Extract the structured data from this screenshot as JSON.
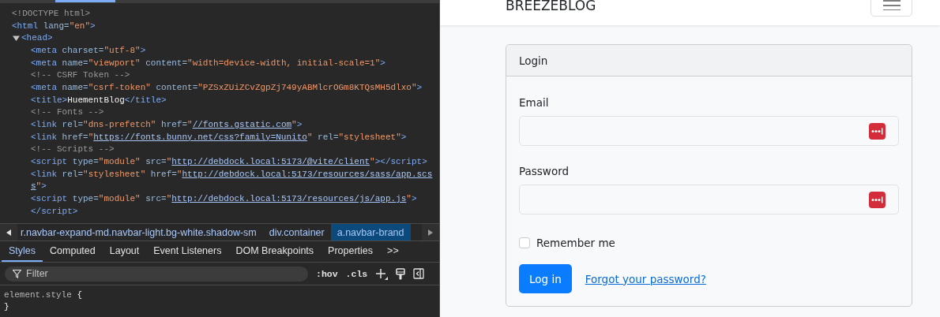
{
  "devtools": {
    "elements_tree": [
      {
        "lines": [
          [
            {
              "kind": "doctype",
              "text": "<!DOCTYPE html>"
            }
          ]
        ]
      },
      {
        "lines": [
          [
            {
              "kind": "tag",
              "text": "<html"
            },
            {
              "kind": "attr",
              "text": " lang="
            },
            {
              "kind": "value",
              "text": "\"en\""
            },
            {
              "kind": "tag",
              "text": ">"
            }
          ]
        ],
        "children": [
          {
            "expanded": true,
            "lines": [
              [
                {
                  "kind": "tag",
                  "text": "<head>"
                }
              ]
            ],
            "children": [
              {
                "lines": [
                  [
                    {
                      "kind": "tag",
                      "text": "<meta"
                    },
                    {
                      "kind": "attr",
                      "text": " charset="
                    },
                    {
                      "kind": "value",
                      "text": "\"utf-8\""
                    },
                    {
                      "kind": "tag",
                      "text": ">"
                    }
                  ]
                ]
              },
              {
                "lines": [
                  [
                    {
                      "kind": "tag",
                      "text": "<meta"
                    },
                    {
                      "kind": "attr",
                      "text": " name="
                    },
                    {
                      "kind": "value",
                      "text": "\"viewport\""
                    },
                    {
                      "kind": "attr",
                      "text": " content="
                    },
                    {
                      "kind": "value",
                      "text": "\"width=device-width, initial-scale=1\""
                    },
                    {
                      "kind": "tag",
                      "text": ">"
                    }
                  ]
                ]
              },
              {
                "lines": [
                  [
                    {
                      "kind": "comment",
                      "text": "<!-- CSRF Token -->"
                    }
                  ]
                ]
              },
              {
                "lines": [
                  [
                    {
                      "kind": "tag",
                      "text": "<meta"
                    },
                    {
                      "kind": "attr",
                      "text": " name="
                    },
                    {
                      "kind": "value",
                      "text": "\"csrf-token\""
                    },
                    {
                      "kind": "attr",
                      "text": " content="
                    },
                    {
                      "kind": "value",
                      "text": "\"PZSxZUiZCvZgpZj749yABMlcrOGm8KTQsMH5dlxo\""
                    },
                    {
                      "kind": "tag",
                      "text": ">"
                    }
                  ]
                ]
              },
              {
                "lines": [
                  [
                    {
                      "kind": "tag",
                      "text": "<title>"
                    },
                    {
                      "kind": "text",
                      "text": "HuementBlog"
                    },
                    {
                      "kind": "tag",
                      "text": "</title>"
                    }
                  ]
                ]
              },
              {
                "lines": [
                  [
                    {
                      "kind": "comment",
                      "text": "<!-- Fonts -->"
                    }
                  ]
                ]
              },
              {
                "lines": [
                  [
                    {
                      "kind": "tag",
                      "text": "<link"
                    },
                    {
                      "kind": "attr",
                      "text": " rel="
                    },
                    {
                      "kind": "value",
                      "text": "\"dns-prefetch\""
                    },
                    {
                      "kind": "attr",
                      "text": " href="
                    },
                    {
                      "kind": "quote",
                      "text": "\""
                    },
                    {
                      "kind": "link",
                      "text": "//fonts.gstatic.com"
                    },
                    {
                      "kind": "quote",
                      "text": "\""
                    },
                    {
                      "kind": "tag",
                      "text": ">"
                    }
                  ]
                ]
              },
              {
                "lines": [
                  [
                    {
                      "kind": "tag",
                      "text": "<link"
                    },
                    {
                      "kind": "attr",
                      "text": " href="
                    },
                    {
                      "kind": "quote",
                      "text": "\""
                    },
                    {
                      "kind": "link",
                      "text": "https://fonts.bunny.net/css?family=Nunito"
                    },
                    {
                      "kind": "quote",
                      "text": "\""
                    },
                    {
                      "kind": "attr",
                      "text": " rel="
                    },
                    {
                      "kind": "value",
                      "text": "\"stylesheet\""
                    },
                    {
                      "kind": "tag",
                      "text": ">"
                    }
                  ]
                ]
              },
              {
                "lines": [
                  [
                    {
                      "kind": "comment",
                      "text": "<!-- Scripts -->"
                    }
                  ]
                ]
              },
              {
                "lines": [
                  [
                    {
                      "kind": "tag",
                      "text": "<script"
                    },
                    {
                      "kind": "attr",
                      "text": " type="
                    },
                    {
                      "kind": "value",
                      "text": "\"module\""
                    },
                    {
                      "kind": "attr",
                      "text": " src="
                    },
                    {
                      "kind": "quote",
                      "text": "\""
                    },
                    {
                      "kind": "link",
                      "text": "http://debdock.local:5173/@vite/client"
                    },
                    {
                      "kind": "quote",
                      "text": "\""
                    },
                    {
                      "kind": "tag",
                      "text": "></script>"
                    }
                  ]
                ]
              },
              {
                "lines": [
                  [
                    {
                      "kind": "tag",
                      "text": "<link"
                    },
                    {
                      "kind": "attr",
                      "text": " rel="
                    },
                    {
                      "kind": "value",
                      "text": "\"stylesheet\""
                    },
                    {
                      "kind": "attr",
                      "text": " href="
                    },
                    {
                      "kind": "quote",
                      "text": "\""
                    },
                    {
                      "kind": "link",
                      "text": "http://debdock.local:5173/resources/sass/app.scs"
                    }
                  ],
                  [
                    {
                      "kind": "link",
                      "text": "s"
                    },
                    {
                      "kind": "quote",
                      "text": "\""
                    },
                    {
                      "kind": "tag",
                      "text": ">"
                    }
                  ]
                ]
              },
              {
                "lines": [
                  [
                    {
                      "kind": "tag",
                      "text": "<script"
                    },
                    {
                      "kind": "attr",
                      "text": " type="
                    },
                    {
                      "kind": "value",
                      "text": "\"module\""
                    },
                    {
                      "kind": "attr",
                      "text": " src="
                    },
                    {
                      "kind": "quote",
                      "text": "\""
                    },
                    {
                      "kind": "link",
                      "text": "http://debdock.local:5173/resources/js/app.js"
                    },
                    {
                      "kind": "quote",
                      "text": "\""
                    },
                    {
                      "kind": "tag",
                      "text": ">"
                    }
                  ],
                  [
                    {
                      "kind": "tag",
                      "text": "</script>"
                    }
                  ]
                ]
              }
            ]
          }
        ]
      }
    ],
    "breadcrumbs": [
      {
        "label": "r.navbar-expand-md.navbar-light.bg-white.shadow-sm",
        "selected": false
      },
      {
        "label": "div.container",
        "selected": false
      },
      {
        "label": "a.navbar-brand",
        "selected": true
      }
    ],
    "tabs": [
      {
        "label": "Styles",
        "selected": true
      },
      {
        "label": "Computed",
        "selected": false
      },
      {
        "label": "Layout",
        "selected": false
      },
      {
        "label": "Event Listeners",
        "selected": false
      },
      {
        "label": "DOM Breakpoints",
        "selected": false
      },
      {
        "label": "Properties",
        "selected": false
      }
    ],
    "more_tabs": ">>",
    "filter": {
      "placeholder": "Filter"
    },
    "toolbar": [
      ":hov",
      ".cls"
    ],
    "rules": [
      {
        "selector": "element.style",
        "open": "{",
        "close": "}"
      }
    ]
  },
  "page": {
    "navbar": {
      "brand": "BREEZEBLOG"
    },
    "card": {
      "header": "Login",
      "fields": [
        {
          "label": "Email"
        },
        {
          "label": "Password"
        }
      ],
      "remember": {
        "label": "Remember me",
        "checked": false
      },
      "submit": "Log in",
      "forgot_link": "Forgot your password?"
    }
  }
}
